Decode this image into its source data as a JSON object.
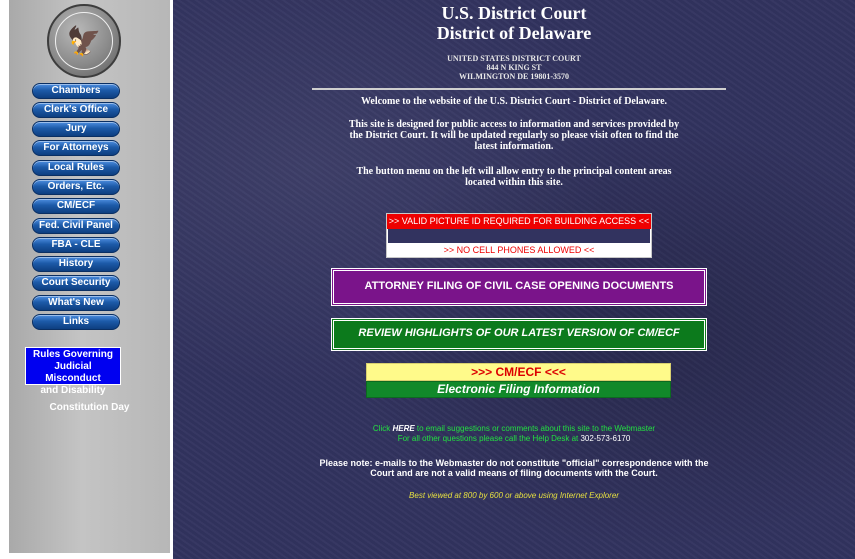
{
  "sidebar": {
    "seal_icon": "us-court-seal",
    "nav_items": [
      {
        "label": "Chambers"
      },
      {
        "label": "Clerk's Office"
      },
      {
        "label": "Jury"
      },
      {
        "label": "For Attorneys"
      },
      {
        "label": "Local Rules"
      },
      {
        "label": "Orders, Etc."
      },
      {
        "label": "CM/ECF"
      },
      {
        "label": "Fed. Civil Panel"
      },
      {
        "label": "FBA - CLE"
      },
      {
        "label": "History"
      },
      {
        "label": "Court Security"
      },
      {
        "label": "What's New"
      },
      {
        "label": "Links"
      }
    ],
    "rules_box": {
      "line1": "Rules Governing",
      "line2": "Judicial Misconduct",
      "line3": "and Disability"
    },
    "constitution_label": "Constitution Day"
  },
  "header": {
    "title": "U.S. District Court",
    "subtitle": "District of Delaware",
    "address_1": "UNITED STATES DISTRICT COURT",
    "address_2": "844 N KING ST",
    "address_3": "WILMINGTON DE 19801-3570"
  },
  "content": {
    "welcome": "Welcome to the website of the U.S. District Court - District of Delaware.",
    "intro_1": "This site is designed for public access to information and services provided by",
    "intro_2": "the District Court.  It will be updated regularly so please visit often to find the",
    "intro_3": "latest information.",
    "menu_1": "The button menu on the left will allow entry to the principal content areas",
    "menu_2": "located within this site."
  },
  "notices": {
    "id_required": ">> VALID PICTURE ID REQUIRED FOR BUILDING ACCESS <<",
    "no_phones": ">> NO CELL PHONES ALLOWED <<"
  },
  "buttons": {
    "attorney_filing": "ATTORNEY FILING OF CIVIL CASE OPENING DOCUMENTS",
    "review_highlights": "REVIEW HIGHLIGHTS OF OUR LATEST VERSION OF CM/ECF",
    "cmecf_title": ">>>  CM/ECF  <<<",
    "cmecf_subtitle": "Electronic Filing Information"
  },
  "footer": {
    "click_prefix": "Click ",
    "click_here": "HERE",
    "click_suffix": " to email suggestions or comments about this site to the Webmaster",
    "help_text": "For all other questions please call the Help Desk at ",
    "help_phone": "302-573-6170",
    "note_1": "Please note: e-mails to the Webmaster do not constitute \"official\" correspondence with the",
    "note_2": "Court and are not a valid means of filing documents with the Court.",
    "best_viewed": "Best viewed at 800 by 600 or above using Internet Explorer"
  },
  "colors": {
    "main_background": "#32335f",
    "sidebar_background": "#b9b9b9",
    "nav_button": "#1c5aa8",
    "attorney_button": "#7a148a",
    "review_button": "#0c7a1c",
    "cmecf_yellow": "#fffa8a",
    "notice_red": "#ee0000"
  }
}
